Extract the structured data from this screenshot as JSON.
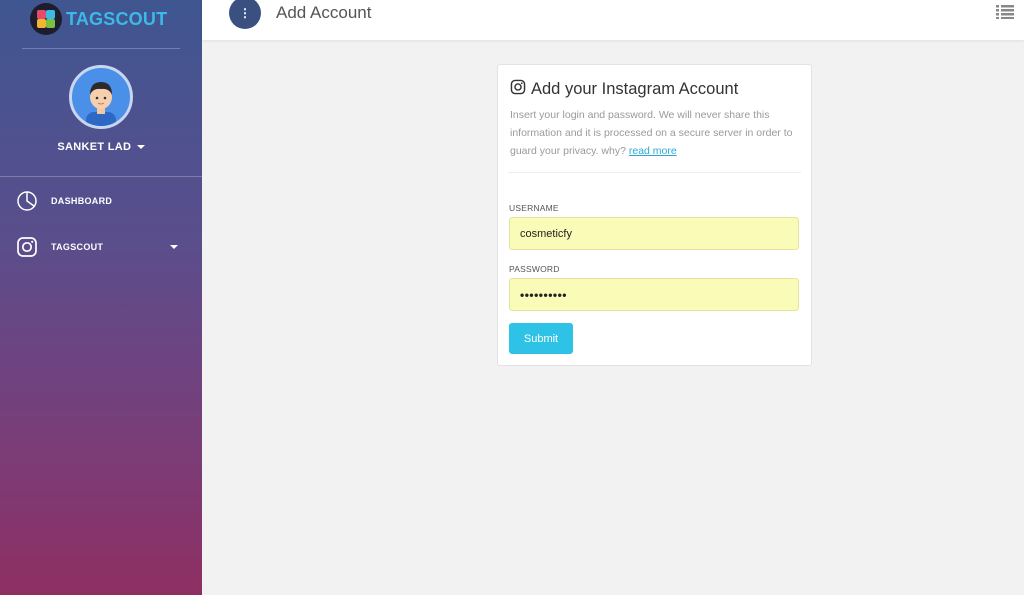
{
  "app": {
    "brand": "TAGSCOUT"
  },
  "header": {
    "page_title": "Add Account",
    "menu_glyph": "⋮"
  },
  "sidebar": {
    "user_name": "SANKET LAD",
    "items": [
      {
        "label": "DASHBOARD",
        "icon": "dashboard-icon"
      },
      {
        "label": "TAGSCOUT",
        "icon": "instagram-icon"
      }
    ]
  },
  "card": {
    "title": "Add your Instagram Account",
    "description": "Insert your login and password. We will never share this information and it is processed on a secure server in order to guard your privacy. why?",
    "read_more": "read more",
    "username_label": "USERNAME",
    "username_value": "cosmeticfy",
    "password_label": "PASSWORD",
    "password_value": "••••••••••",
    "submit_label": "Submit"
  },
  "colors": {
    "accent": "#2ec3e6",
    "input_fill": "#fafbb7",
    "brand_text": "#3db9e8"
  }
}
